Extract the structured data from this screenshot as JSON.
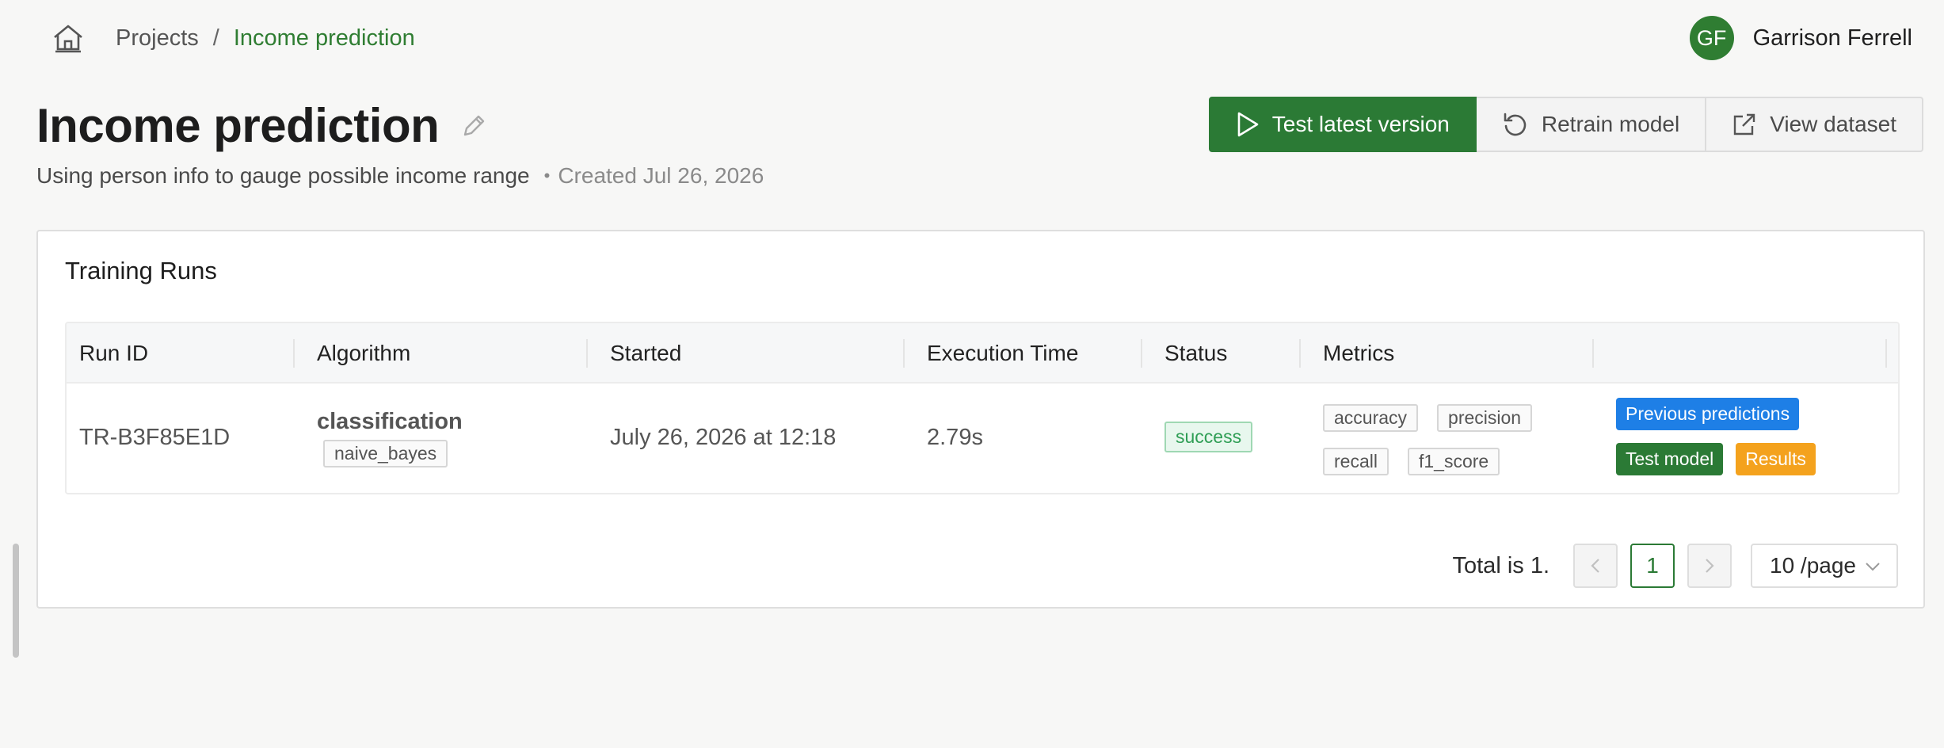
{
  "breadcrumb": {
    "projects": "Projects",
    "separator": "/",
    "current": "Income prediction"
  },
  "user": {
    "initials": "GF",
    "name": "Garrison Ferrell"
  },
  "header": {
    "title": "Income prediction",
    "description": "Using person info to gauge possible income range",
    "created": "Created Jul 26, 2026"
  },
  "actions": {
    "test_latest": "Test latest version",
    "retrain": "Retrain model",
    "view_dataset": "View dataset"
  },
  "training_runs": {
    "title": "Training Runs",
    "columns": [
      "Run ID",
      "Algorithm",
      "Started",
      "Execution Time",
      "Status",
      "Metrics",
      ""
    ],
    "rows": [
      {
        "run_id": "TR-B3F85E1D",
        "algorithm": "classification",
        "algorithm_variant": "naive_bayes",
        "started": "July 26, 2026 at 12:18",
        "execution_time": "2.79s",
        "status": "success",
        "metrics": [
          "accuracy",
          "precision",
          "recall",
          "f1_score"
        ],
        "buttons": {
          "previous": "Previous predictions",
          "test": "Test model",
          "results": "Results"
        }
      }
    ]
  },
  "pagination": {
    "total": "Total is 1.",
    "current_page": "1",
    "page_size": "10 /page"
  },
  "colors": {
    "brand_green": "#2b7a35",
    "link_green": "#2f7d32",
    "blue": "#1e7fe6",
    "orange": "#f4a21d",
    "success": "#2f9e55"
  },
  "icons": [
    "home-icon",
    "edit-icon",
    "play-icon",
    "refresh-icon",
    "external-link-icon",
    "chevron-left-icon",
    "chevron-right-icon",
    "chevron-down-icon"
  ]
}
